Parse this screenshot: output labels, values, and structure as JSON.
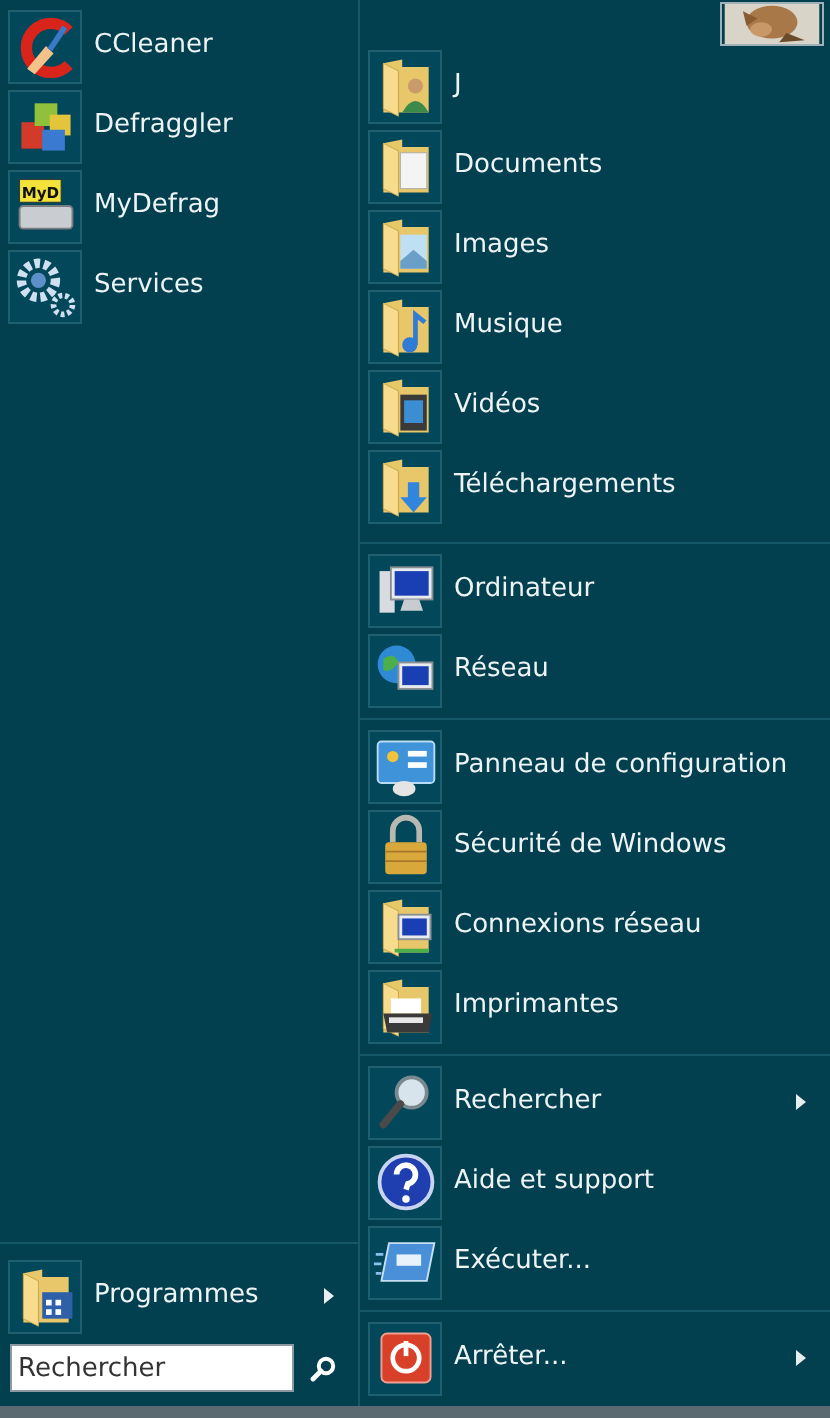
{
  "left": {
    "pinned": [
      {
        "label": "CCleaner",
        "kind": "cleaner"
      },
      {
        "label": "Defraggler",
        "kind": "cubes"
      },
      {
        "label": "MyDefrag",
        "kind": "drive",
        "badge": "MyD"
      },
      {
        "label": "Services",
        "kind": "gears"
      }
    ],
    "programs": {
      "label": "Programmes",
      "kind": "programs",
      "submenu": true
    },
    "search": {
      "placeholder": "Rechercher"
    }
  },
  "right": {
    "avatar": {
      "kind": "picture"
    },
    "groups": [
      [
        {
          "label": "J",
          "kind": "folder-user",
          "submenu": false
        },
        {
          "label": "Documents",
          "kind": "folder-docs",
          "submenu": false
        },
        {
          "label": "Images",
          "kind": "folder-images",
          "submenu": false
        },
        {
          "label": "Musique",
          "kind": "folder-music",
          "submenu": false
        },
        {
          "label": "Vidéos",
          "kind": "folder-videos",
          "submenu": false
        },
        {
          "label": "Téléchargements",
          "kind": "folder-downloads",
          "submenu": false
        }
      ],
      [
        {
          "label": "Ordinateur",
          "kind": "computer",
          "submenu": false
        },
        {
          "label": "Réseau",
          "kind": "network",
          "submenu": false
        }
      ],
      [
        {
          "label": "Panneau de configuration",
          "kind": "control-panel",
          "submenu": false
        },
        {
          "label": "Sécurité de Windows",
          "kind": "padlock",
          "submenu": false
        },
        {
          "label": "Connexions réseau",
          "kind": "folder-network",
          "submenu": false
        },
        {
          "label": "Imprimantes",
          "kind": "printer",
          "submenu": false
        }
      ],
      [
        {
          "label": "Rechercher",
          "kind": "magnifier",
          "submenu": true
        },
        {
          "label": "Aide et support",
          "kind": "help",
          "submenu": false
        },
        {
          "label": "Exécuter...",
          "kind": "run",
          "submenu": false
        }
      ],
      [
        {
          "label": "Arrêter...",
          "kind": "power",
          "submenu": true
        }
      ]
    ]
  }
}
